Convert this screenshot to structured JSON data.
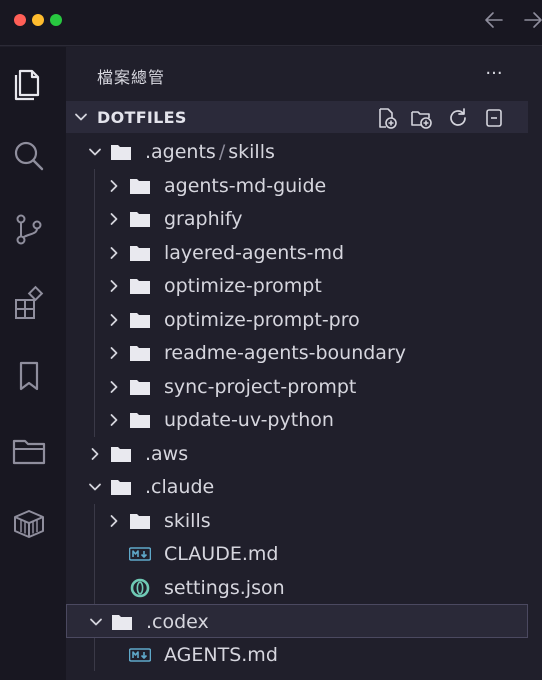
{
  "sidebar": {
    "title": "檔案總管",
    "more": "···",
    "section_title": "DOTFILES"
  },
  "tree": [
    {
      "label": ".agents",
      "label2": "skills",
      "depth": 0,
      "kind": "folder",
      "expanded": true
    },
    {
      "label": "agents-md-guide",
      "depth": 1,
      "kind": "folder",
      "expanded": false
    },
    {
      "label": "graphify",
      "depth": 1,
      "kind": "folder",
      "expanded": false
    },
    {
      "label": "layered-agents-md",
      "depth": 1,
      "kind": "folder",
      "expanded": false
    },
    {
      "label": "optimize-prompt",
      "depth": 1,
      "kind": "folder",
      "expanded": false
    },
    {
      "label": "optimize-prompt-pro",
      "depth": 1,
      "kind": "folder",
      "expanded": false
    },
    {
      "label": "readme-agents-boundary",
      "depth": 1,
      "kind": "folder",
      "expanded": false
    },
    {
      "label": "sync-project-prompt",
      "depth": 1,
      "kind": "folder",
      "expanded": false
    },
    {
      "label": "update-uv-python",
      "depth": 1,
      "kind": "folder",
      "expanded": false
    },
    {
      "label": ".aws",
      "depth": 0,
      "kind": "folder",
      "expanded": false
    },
    {
      "label": ".claude",
      "depth": 0,
      "kind": "folder",
      "expanded": true
    },
    {
      "label": "skills",
      "depth": 1,
      "kind": "folder",
      "expanded": false
    },
    {
      "label": "CLAUDE.md",
      "depth": 1,
      "kind": "markdown"
    },
    {
      "label": "settings.json",
      "depth": 1,
      "kind": "json"
    },
    {
      "label": ".codex",
      "depth": 0,
      "kind": "folder",
      "expanded": true,
      "selected": true
    },
    {
      "label": "AGENTS.md",
      "depth": 1,
      "kind": "markdown"
    }
  ],
  "icons": {
    "markdown_color": "#5fa8c9",
    "json_color": "#6fc9b5",
    "accent": "#2b2a3a"
  }
}
